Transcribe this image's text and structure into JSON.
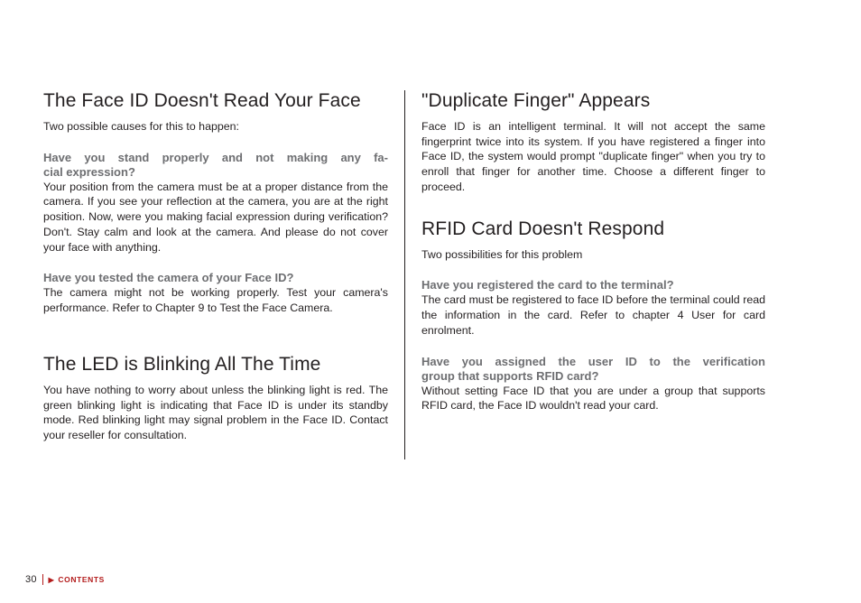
{
  "left": {
    "section1": {
      "heading": "The Face ID Doesn't Read Your Face",
      "intro": "Two possible causes for this to happen:",
      "q1_line1": "Have you stand properly and not making any fa-",
      "q1_line2": "cial expression?",
      "a1": "Your position from the camera must be at a proper distance from the camera. If you see your reflection at the camera, you are at the right position. Now, were you making facial expression during verification? Don't. Stay calm and look at the camera. And please do not cover your face with anything.",
      "q2": "Have you tested the camera of your Face ID?",
      "a2": "The camera might not be working properly. Test your camera's performance. Refer to Chapter 9 to Test the Face Camera."
    },
    "section2": {
      "heading": "The LED is Blinking All The Time",
      "body": "You have nothing to worry about unless the blinking light is red. The green blinking light is indicating that Face ID is under its standby mode. Red blinking light may signal problem in the Face ID. Contact your reseller for consultation."
    }
  },
  "right": {
    "section1": {
      "heading": "\"Duplicate Finger\" Appears",
      "body": "Face ID is an intelligent terminal. It will not accept the same fingerprint twice into its system. If you have registered a finger into Face ID, the system would prompt \"duplicate finger\" when you try to enroll that finger for another time. Choose a different finger to proceed."
    },
    "section2": {
      "heading": "RFID Card Doesn't Respond",
      "intro": "Two possibilities for this problem",
      "q1": "Have you registered the card to the terminal?",
      "a1": "The card must be registered to face ID before the terminal could read the information in the card. Refer to chapter 4 User for card enrolment.",
      "q2_line1": "Have you assigned the user ID to the verification",
      "q2_line2": "group that supports RFID card?",
      "a2": "Without setting Face ID that you are under a group that supports RFID card, the Face ID wouldn't read your card."
    }
  },
  "footer": {
    "page": "30",
    "contents": "CONTENTS"
  }
}
